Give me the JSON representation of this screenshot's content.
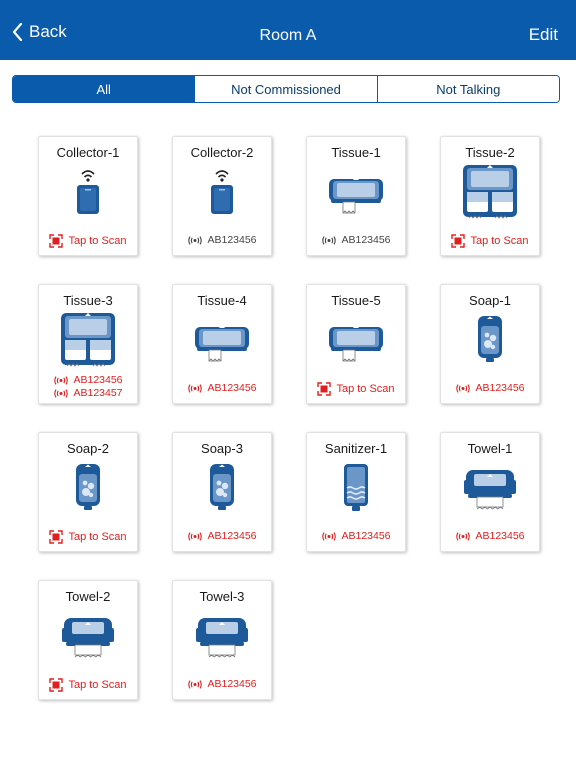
{
  "navbar": {
    "back_label": "Back",
    "title": "Room A",
    "edit_label": "Edit"
  },
  "filters": {
    "tabs": [
      "All",
      "Not Commissioned",
      "Not Talking"
    ],
    "active": "All"
  },
  "devices": [
    {
      "name": "Collector-1",
      "type": "collector",
      "status": "scan",
      "scan_label": "Tap to Scan"
    },
    {
      "name": "Collector-2",
      "type": "collector",
      "status": "ok",
      "tags": [
        "AB123456"
      ]
    },
    {
      "name": "Tissue-1",
      "type": "tissue-single",
      "status": "ok",
      "tags": [
        "AB123456"
      ]
    },
    {
      "name": "Tissue-2",
      "type": "tissue-double",
      "status": "scan",
      "scan_label": "Tap to Scan"
    },
    {
      "name": "Tissue-3",
      "type": "tissue-double",
      "status": "error",
      "tags": [
        "AB123456",
        "AB123457"
      ]
    },
    {
      "name": "Tissue-4",
      "type": "tissue-single",
      "status": "error",
      "tags": [
        "AB123456"
      ]
    },
    {
      "name": "Tissue-5",
      "type": "tissue-single",
      "status": "scan",
      "scan_label": "Tap to Scan"
    },
    {
      "name": "Soap-1",
      "type": "soap",
      "status": "error",
      "tags": [
        "AB123456"
      ]
    },
    {
      "name": "Soap-2",
      "type": "soap",
      "status": "scan",
      "scan_label": "Tap to Scan"
    },
    {
      "name": "Soap-3",
      "type": "soap",
      "status": "error",
      "tags": [
        "AB123456"
      ]
    },
    {
      "name": "Sanitizer-1",
      "type": "sanitizer",
      "status": "error",
      "tags": [
        "AB123456"
      ]
    },
    {
      "name": "Towel-1",
      "type": "towel",
      "status": "error",
      "tags": [
        "AB123456"
      ]
    },
    {
      "name": "Towel-2",
      "type": "towel",
      "status": "scan",
      "scan_label": "Tap to Scan"
    },
    {
      "name": "Towel-3",
      "type": "towel",
      "status": "error",
      "tags": [
        "AB123456"
      ]
    }
  ],
  "colors": {
    "brand": "#0a5bab",
    "error": "#e02020",
    "text": "#1a1a1a"
  }
}
